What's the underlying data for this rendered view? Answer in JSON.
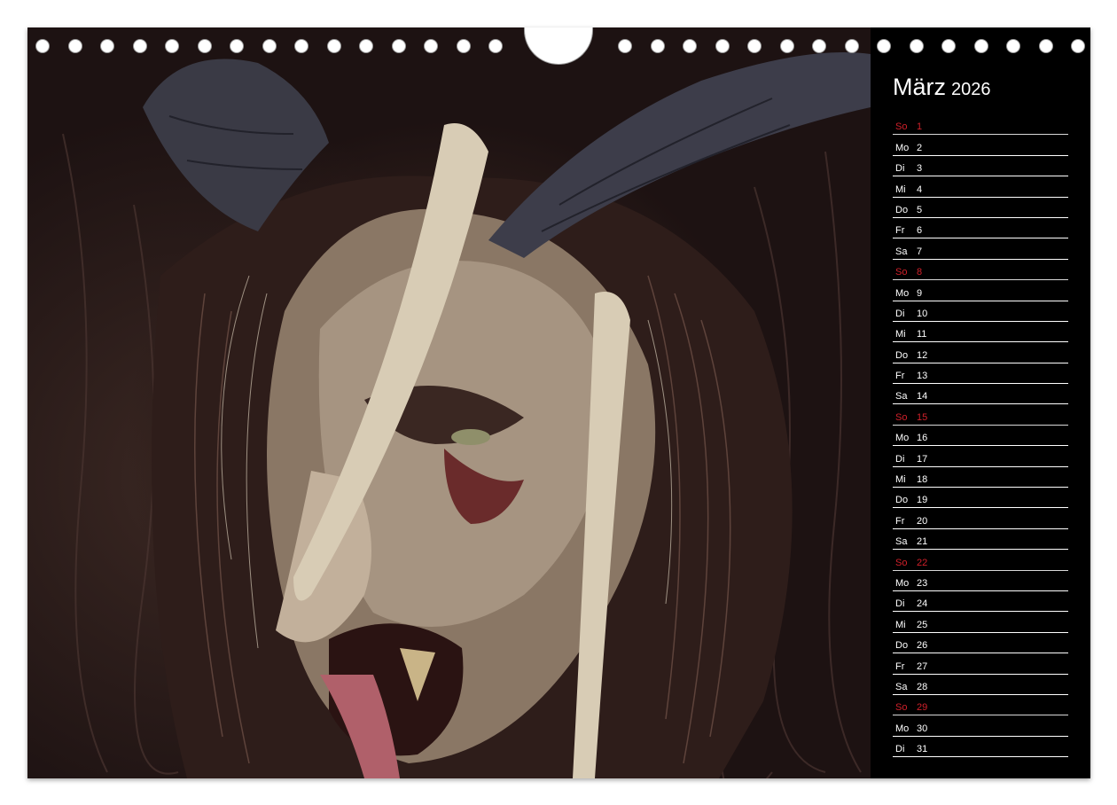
{
  "calendar": {
    "month": "März",
    "year": "2026",
    "accent_color": "#d0202a",
    "photo": {
      "subject": "krampus-mask-photo"
    },
    "days": [
      {
        "wd": "So",
        "d": "1",
        "sunday": true
      },
      {
        "wd": "Mo",
        "d": "2"
      },
      {
        "wd": "Di",
        "d": "3"
      },
      {
        "wd": "Mi",
        "d": "4"
      },
      {
        "wd": "Do",
        "d": "5"
      },
      {
        "wd": "Fr",
        "d": "6"
      },
      {
        "wd": "Sa",
        "d": "7"
      },
      {
        "wd": "So",
        "d": "8",
        "sunday": true
      },
      {
        "wd": "Mo",
        "d": "9"
      },
      {
        "wd": "Di",
        "d": "10"
      },
      {
        "wd": "Mi",
        "d": "11"
      },
      {
        "wd": "Do",
        "d": "12"
      },
      {
        "wd": "Fr",
        "d": "13"
      },
      {
        "wd": "Sa",
        "d": "14"
      },
      {
        "wd": "So",
        "d": "15",
        "sunday": true
      },
      {
        "wd": "Mo",
        "d": "16"
      },
      {
        "wd": "Di",
        "d": "17"
      },
      {
        "wd": "Mi",
        "d": "18"
      },
      {
        "wd": "Do",
        "d": "19"
      },
      {
        "wd": "Fr",
        "d": "20"
      },
      {
        "wd": "Sa",
        "d": "21"
      },
      {
        "wd": "So",
        "d": "22",
        "sunday": true
      },
      {
        "wd": "Mo",
        "d": "23"
      },
      {
        "wd": "Di",
        "d": "24"
      },
      {
        "wd": "Mi",
        "d": "25"
      },
      {
        "wd": "Do",
        "d": "26"
      },
      {
        "wd": "Fr",
        "d": "27"
      },
      {
        "wd": "Sa",
        "d": "28"
      },
      {
        "wd": "So",
        "d": "29",
        "sunday": true
      },
      {
        "wd": "Mo",
        "d": "30"
      },
      {
        "wd": "Di",
        "d": "31"
      }
    ]
  }
}
